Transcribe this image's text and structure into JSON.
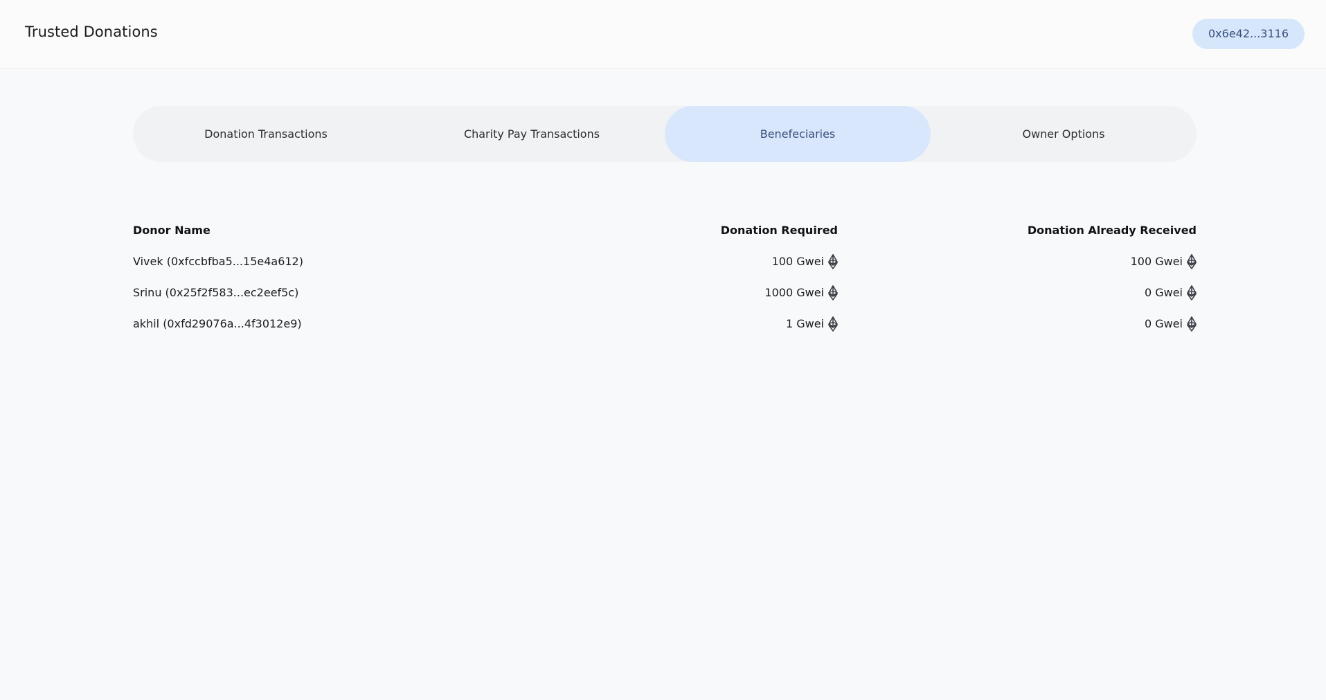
{
  "header": {
    "title": "Trusted Donations",
    "wallet_address": "0x6e42...3116"
  },
  "tabs": [
    {
      "label": "Donation Transactions",
      "active": false
    },
    {
      "label": "Charity Pay Transactions",
      "active": false
    },
    {
      "label": "Benefeciaries",
      "active": true
    },
    {
      "label": "Owner Options",
      "active": false
    }
  ],
  "table": {
    "columns": [
      "Donor Name",
      "Donation Required",
      "Donation Already Received"
    ],
    "rows": [
      {
        "name": "Vivek (0xfccbfba5...15e4a612)",
        "required": "100 Gwei",
        "received": "100 Gwei"
      },
      {
        "name": "Srinu (0x25f2f583...ec2eef5c)",
        "required": "1000 Gwei",
        "received": "0 Gwei"
      },
      {
        "name": "akhil (0xfd29076a...4f3012e9)",
        "required": "1 Gwei",
        "received": "0 Gwei"
      }
    ],
    "currency_icon": "ethereum-icon"
  },
  "colors": {
    "accent_bg": "#d8e7fb",
    "accent_text": "#3a4f7d",
    "tab_track": "#f1f2f4",
    "page_bg": "#f8f9fb"
  }
}
